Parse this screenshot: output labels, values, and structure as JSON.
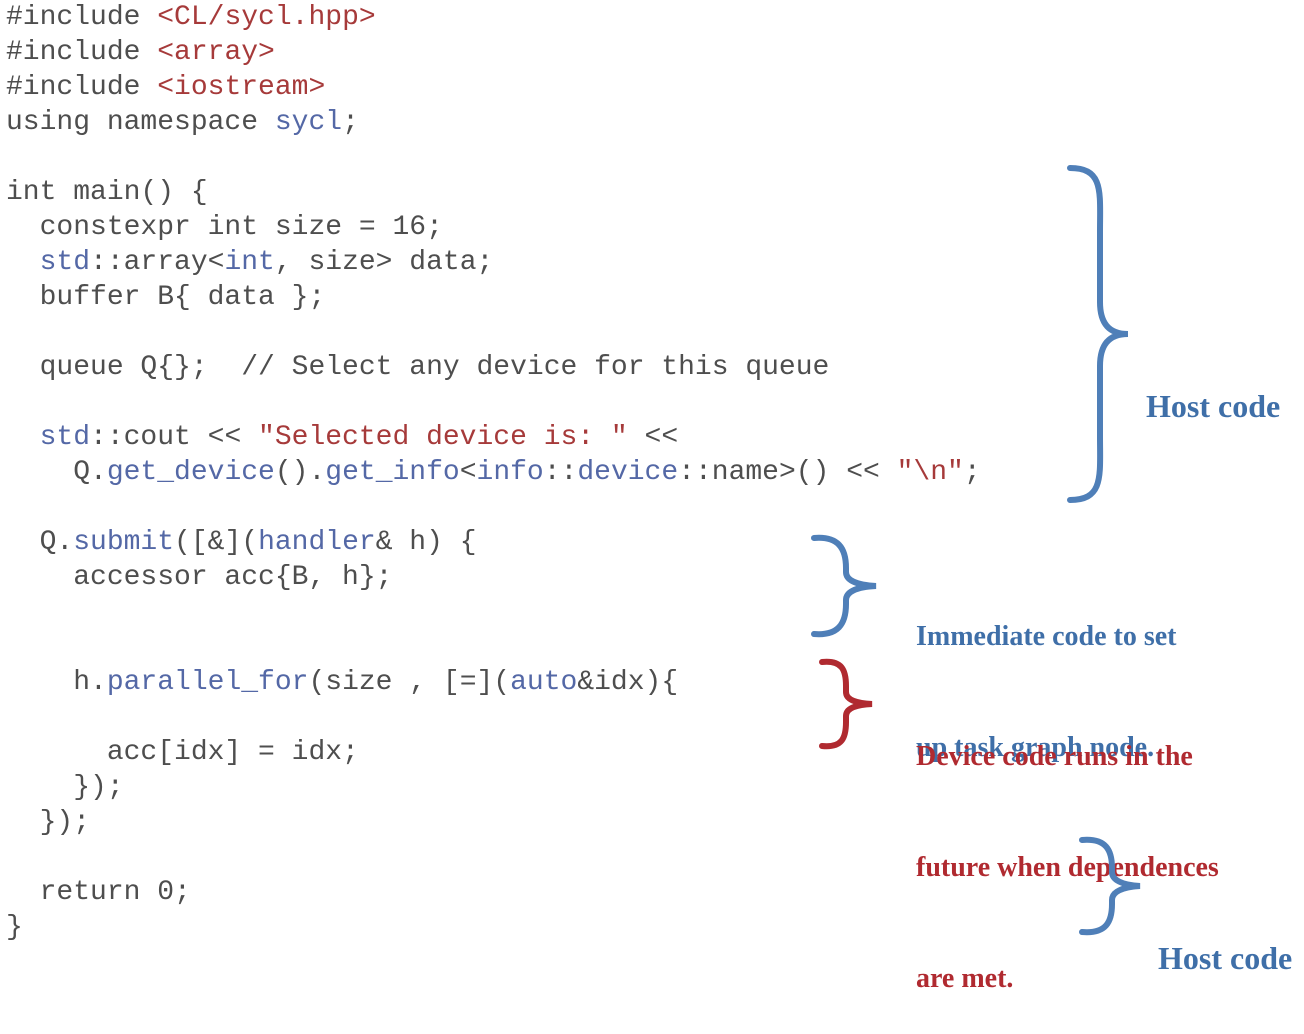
{
  "code_lines": [
    [
      {
        "t": "#include ",
        "c": "kw"
      },
      {
        "t": "<CL/sycl.hpp>",
        "c": "str"
      }
    ],
    [
      {
        "t": "#include ",
        "c": "kw"
      },
      {
        "t": "<array>",
        "c": "str"
      }
    ],
    [
      {
        "t": "#include ",
        "c": "kw"
      },
      {
        "t": "<iostream>",
        "c": "str"
      }
    ],
    [
      {
        "t": "using namespace ",
        "c": "kw"
      },
      {
        "t": "sycl",
        "c": "ty"
      },
      {
        "t": ";",
        "c": "kw"
      }
    ],
    [],
    [
      {
        "t": "int main() {",
        "c": "kw"
      }
    ],
    [
      {
        "t": "  constexpr int size = 16;",
        "c": "kw"
      }
    ],
    [
      {
        "t": "  std",
        "c": "ty"
      },
      {
        "t": "::array<",
        "c": "kw"
      },
      {
        "t": "int",
        "c": "ty"
      },
      {
        "t": ", size> data;",
        "c": "kw"
      }
    ],
    [
      {
        "t": "  buffer B{ data };",
        "c": "kw"
      }
    ],
    [],
    [
      {
        "t": "  queue Q{};  // Select any device for this queue",
        "c": "cm"
      }
    ],
    [],
    [
      {
        "t": "  std",
        "c": "ty"
      },
      {
        "t": "::cout << ",
        "c": "kw"
      },
      {
        "t": "\"Selected device is: \"",
        "c": "str"
      },
      {
        "t": " <<",
        "c": "kw"
      }
    ],
    [
      {
        "t": "    Q.",
        "c": "kw"
      },
      {
        "t": "get_device",
        "c": "ty"
      },
      {
        "t": "().",
        "c": "kw"
      },
      {
        "t": "get_info",
        "c": "ty"
      },
      {
        "t": "<",
        "c": "kw"
      },
      {
        "t": "info",
        "c": "ty"
      },
      {
        "t": "::",
        "c": "kw"
      },
      {
        "t": "device",
        "c": "ty"
      },
      {
        "t": "::name>() << ",
        "c": "kw"
      },
      {
        "t": "\"\\n\"",
        "c": "str"
      },
      {
        "t": ";",
        "c": "kw"
      }
    ],
    [],
    [
      {
        "t": "  Q.",
        "c": "kw"
      },
      {
        "t": "submit",
        "c": "ty"
      },
      {
        "t": "([&](",
        "c": "kw"
      },
      {
        "t": "handler",
        "c": "ty"
      },
      {
        "t": "& h) {",
        "c": "kw"
      }
    ],
    [
      {
        "t": "    accessor acc{B, h};",
        "c": "kw"
      }
    ],
    [],
    [],
    [
      {
        "t": "    h.",
        "c": "kw"
      },
      {
        "t": "parallel_for",
        "c": "ty"
      },
      {
        "t": "(size , [=](",
        "c": "kw"
      },
      {
        "t": "auto",
        "c": "ty"
      },
      {
        "t": "&idx){",
        "c": "kw"
      }
    ],
    [],
    [
      {
        "t": "      acc[idx] = idx;",
        "c": "kw"
      }
    ],
    [
      {
        "t": "    });",
        "c": "kw"
      }
    ],
    [
      {
        "t": "  });",
        "c": "kw"
      }
    ],
    [],
    [
      {
        "t": "  return 0;",
        "c": "kw"
      }
    ],
    [
      {
        "t": "}",
        "c": "kw"
      }
    ]
  ],
  "annotations": {
    "host_code_top": {
      "lines": [
        "Host code"
      ],
      "color": "#3f6fa8"
    },
    "immediate_code": {
      "lines": [
        "Immediate code to set",
        "up task graph node."
      ],
      "color": "#3f6fa8"
    },
    "device_code": {
      "lines": [
        "Device code runs in the",
        "future when dependences",
        "are met."
      ],
      "color": "#b02a30"
    },
    "host_code_bottom": {
      "lines": [
        "Host code"
      ],
      "color": "#3f6fa8"
    }
  },
  "colors": {
    "keyword": "#4e4e4e",
    "type": "#5468a6",
    "string": "#a63a3a",
    "host_brace": "#4f7fb8",
    "device_brace": "#b02a30"
  }
}
